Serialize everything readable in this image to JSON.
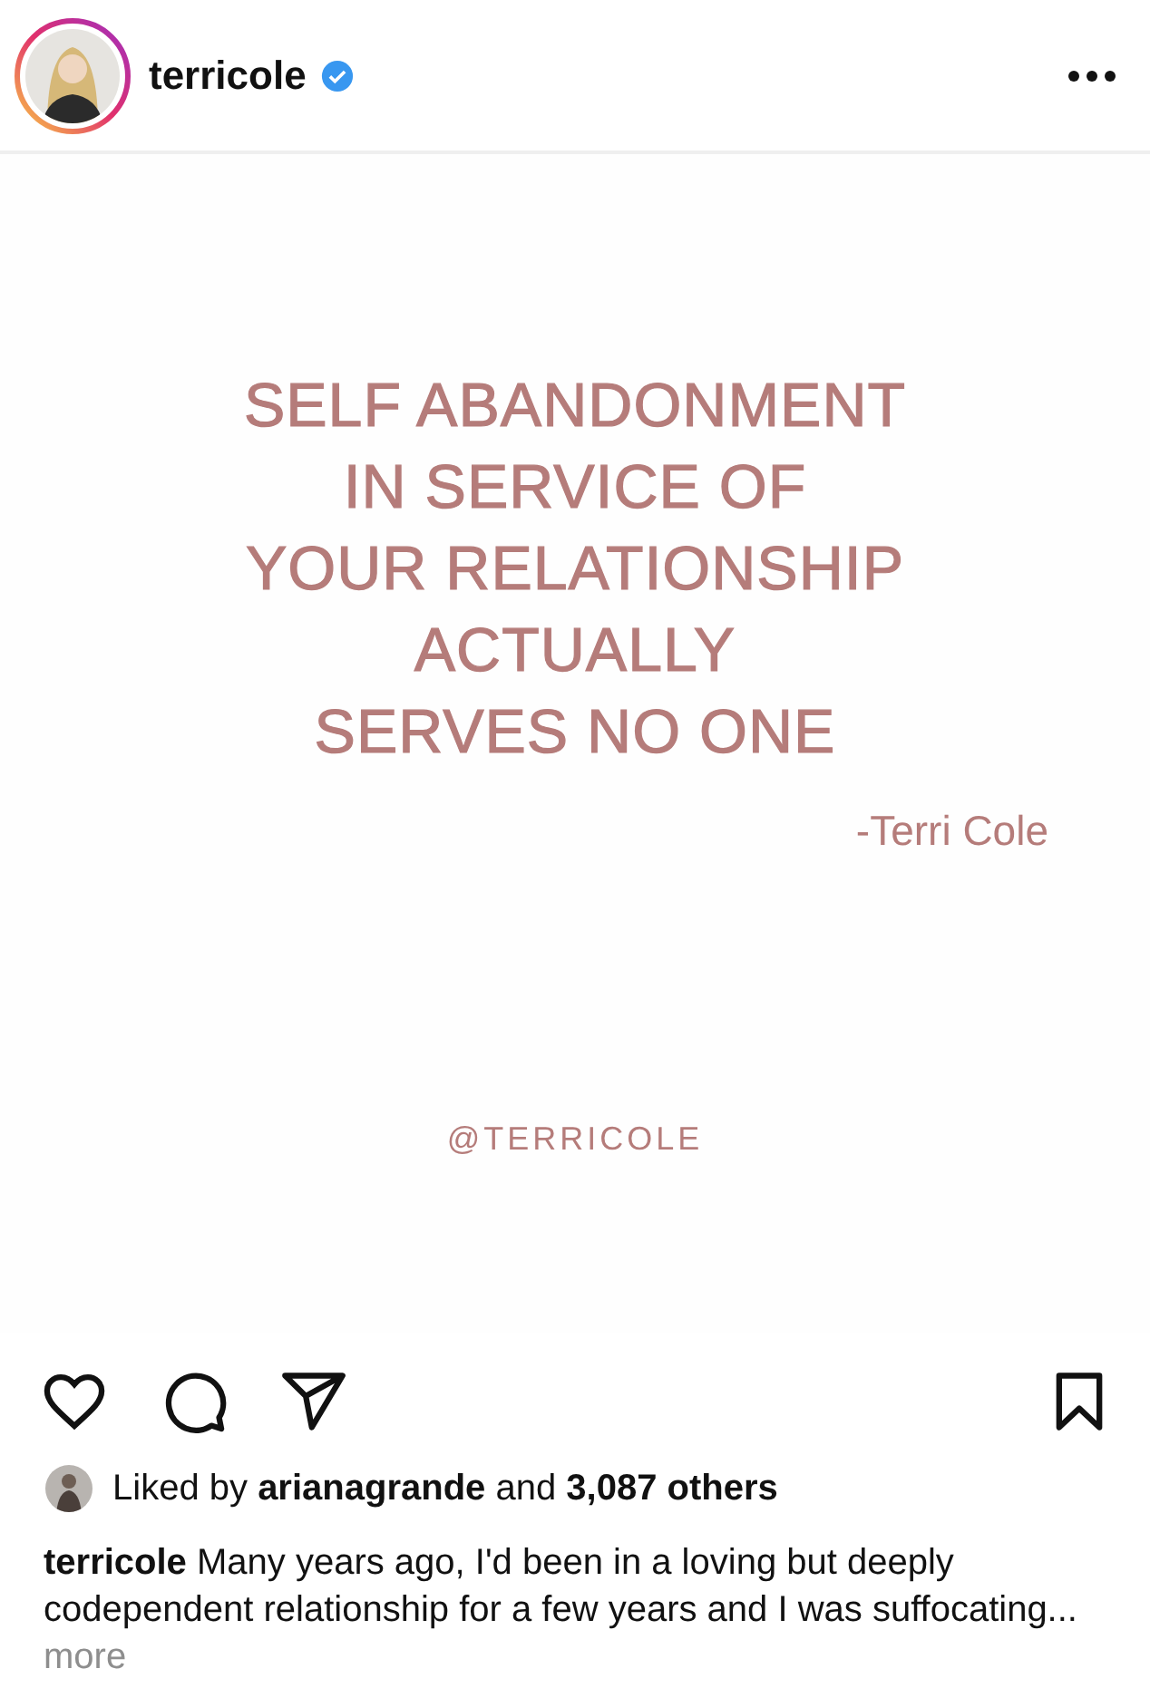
{
  "post_header": {
    "username": "terricole",
    "verified": true
  },
  "post_image": {
    "quote_lines": [
      "SELF ABANDONMENT",
      "IN SERVICE OF",
      "YOUR RELATIONSHIP",
      "ACTUALLY",
      "SERVES NO ONE"
    ],
    "attribution": "-Terri Cole",
    "handle": "@TERRICOLE"
  },
  "likes": {
    "text": "Liked by **arianagrande** and **3,087 others**"
  },
  "caption": {
    "text": "**terricole** Many years ago, I'd been in a loving but deeply codependent relationship for a few years and I was suffocating...",
    "more": "more"
  }
}
